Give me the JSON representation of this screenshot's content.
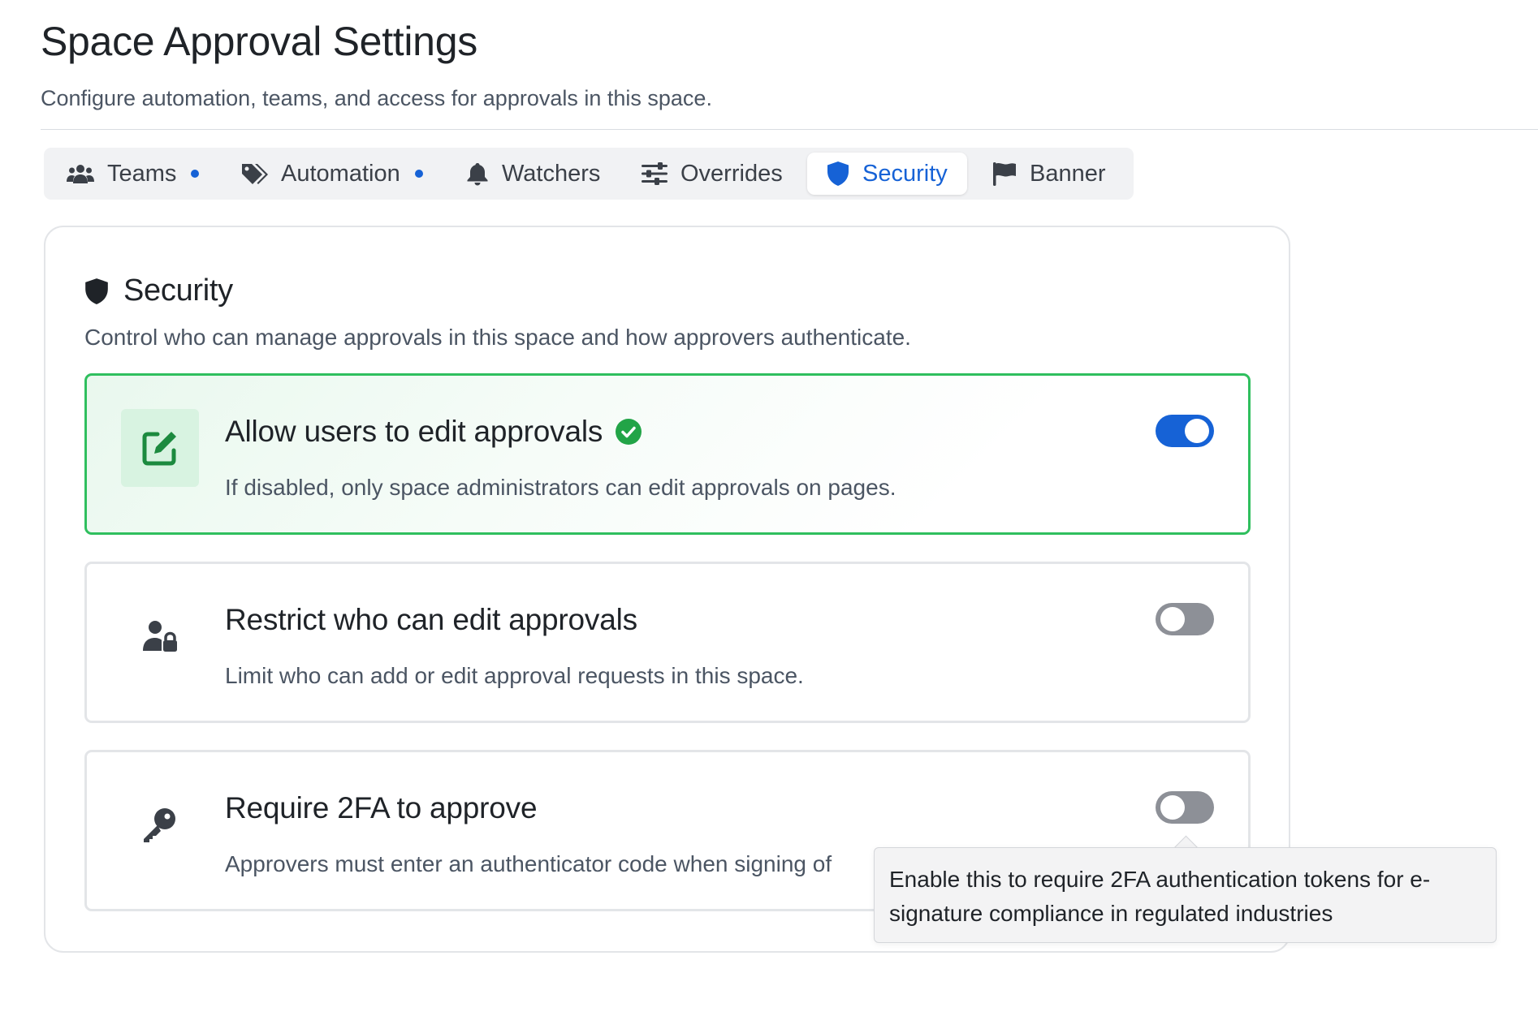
{
  "header": {
    "title": "Space Approval Settings",
    "subtitle": "Configure automation, teams, and access for approvals in this space."
  },
  "tabs": [
    {
      "label": "Teams",
      "icon": "users-icon",
      "has_dot": true
    },
    {
      "label": "Automation",
      "icon": "tags-icon",
      "has_dot": true
    },
    {
      "label": "Watchers",
      "icon": "bell-icon",
      "has_dot": false
    },
    {
      "label": "Overrides",
      "icon": "sliders-icon",
      "has_dot": false
    },
    {
      "label": "Security",
      "icon": "shield-icon",
      "active": true
    },
    {
      "label": "Banner",
      "icon": "flag-icon",
      "has_dot": false
    }
  ],
  "section": {
    "title": "Security",
    "description": "Control who can manage approvals in this space and how approvers authenticate."
  },
  "options": [
    {
      "title": "Allow users to edit approvals",
      "description": "If disabled, only space administrators can edit approvals on pages.",
      "icon": "edit-icon",
      "enabled": true
    },
    {
      "title": "Restrict who can edit approvals",
      "description": "Limit who can add or edit approval requests in this space.",
      "icon": "user-lock-icon",
      "enabled": false
    },
    {
      "title": "Require 2FA to approve",
      "description": "Approvers must enter an authenticator code when signing of",
      "icon": "key-icon",
      "enabled": false
    }
  ],
  "tooltip": {
    "text": "Enable this to require 2FA authentication tokens for e-signature compliance in regulated industries"
  },
  "colors": {
    "accent": "#1662d6",
    "enabled_border": "#2fbf5e",
    "check": "#22a447",
    "toggle_off": "#8d9097"
  }
}
